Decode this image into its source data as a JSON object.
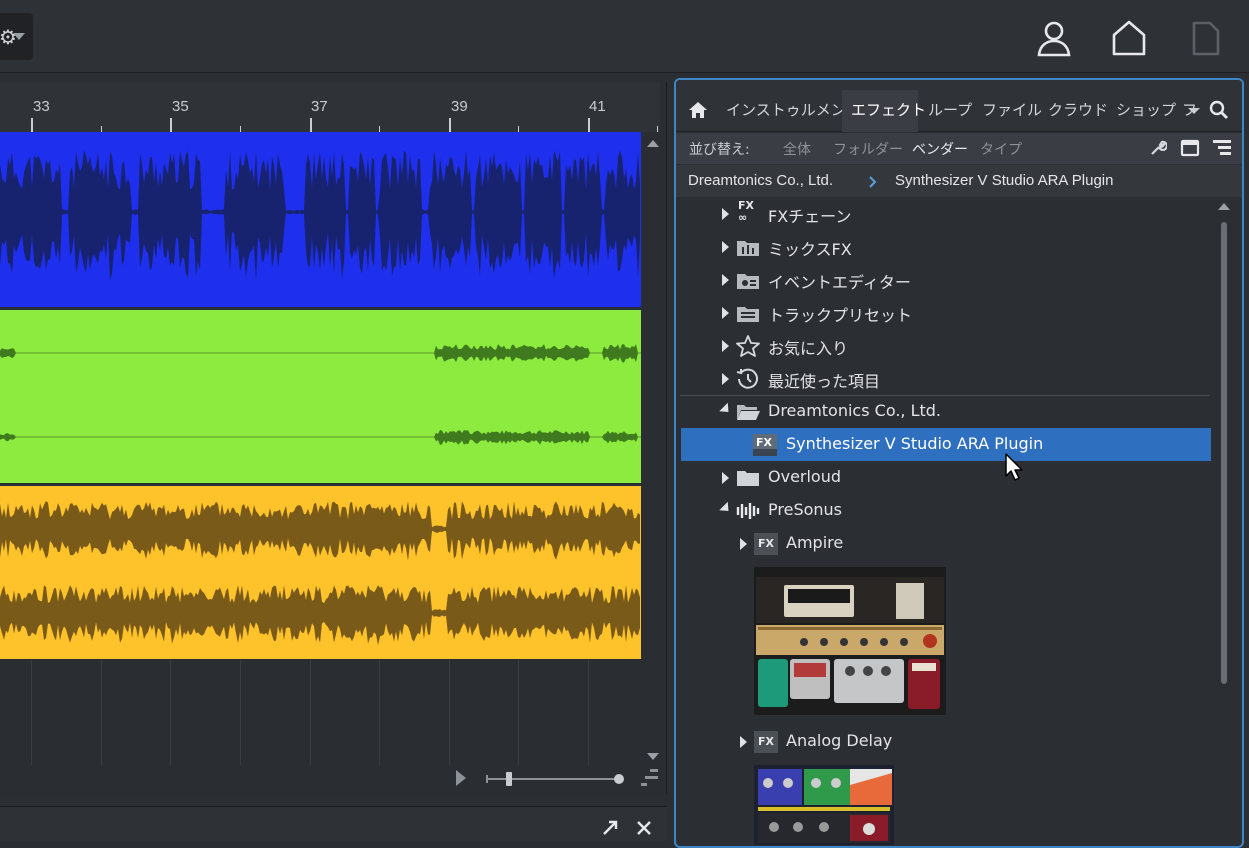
{
  "ruler": {
    "marks": [
      "33",
      "35",
      "37",
      "39",
      "41"
    ]
  },
  "browser": {
    "tabs": [
      {
        "label": "インストゥルメント",
        "active": false
      },
      {
        "label": "エフェクト",
        "active": true
      },
      {
        "label": "ループ",
        "active": false
      },
      {
        "label": "ファイル",
        "active": false
      },
      {
        "label": "クラウド",
        "active": false
      },
      {
        "label": "ショップ",
        "active": false
      },
      {
        "label": "フ",
        "active": false
      }
    ],
    "sort": {
      "label": "並び替え:",
      "options": [
        "全体",
        "フォルダー",
        "ベンダー",
        "タイプ"
      ],
      "selected": "ベンダー"
    },
    "breadcrumb": [
      "Dreamtonics Co., Ltd.",
      "Synthesizer V Studio ARA Plugin"
    ],
    "tree": [
      {
        "label": "FXチェーン",
        "icon": "fx-chain-icon",
        "expanded": false
      },
      {
        "label": "ミックスFX",
        "icon": "mix-fx-icon",
        "expanded": false
      },
      {
        "label": "イベントエディター",
        "icon": "event-editor-icon",
        "expanded": false
      },
      {
        "label": "トラックプリセット",
        "icon": "track-preset-icon",
        "expanded": false
      },
      {
        "label": "お気に入り",
        "icon": "star-icon",
        "expanded": false
      },
      {
        "label": "最近使った項目",
        "icon": "clock-icon",
        "expanded": false
      },
      {
        "label": "Dreamtonics Co., Ltd.",
        "icon": "folder-open-icon",
        "expanded": true
      },
      {
        "label": "Synthesizer V Studio ARA Plugin",
        "icon": "fx-plugin-icon",
        "selected": true
      },
      {
        "label": "Overloud",
        "icon": "folder-icon",
        "expanded": false
      },
      {
        "label": "PreSonus",
        "icon": "presonus-icon",
        "expanded": true
      },
      {
        "label": "Ampire",
        "icon": "fx-badge-icon",
        "expanded": false
      },
      {
        "label": "Analog Delay",
        "icon": "fx-badge-icon",
        "expanded": false
      }
    ],
    "fx_badge": "FX"
  },
  "colors": {
    "accent": "#3e86c6",
    "selection": "#2f6fc0",
    "lane_blue": "#1f2fee",
    "lane_green": "#8ceb3e",
    "lane_yellow": "#fec22a"
  }
}
